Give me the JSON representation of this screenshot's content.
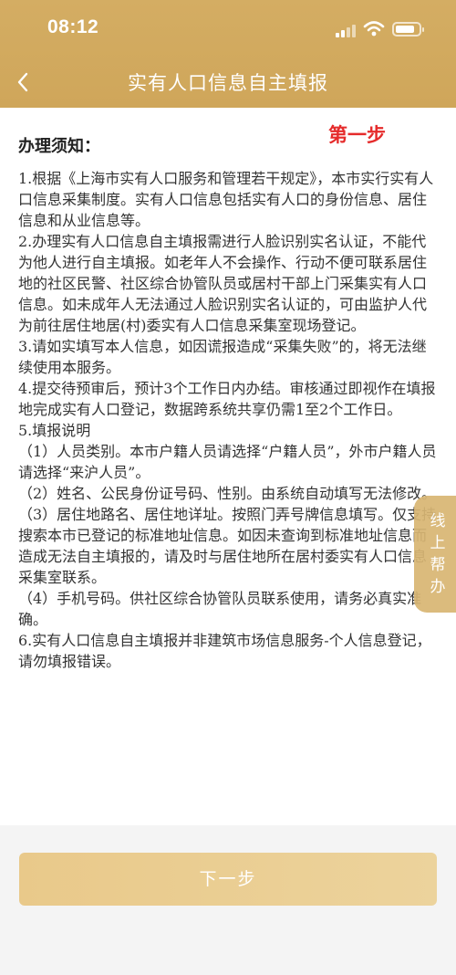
{
  "status_bar": {
    "time": "08:12"
  },
  "header": {
    "title": "实有人口信息自主填报",
    "back_icon": "chevron-left-icon"
  },
  "step_label": "第一步",
  "notice": {
    "title": "办理须知：",
    "paragraphs": [
      "1.根据《上海市实有人口服务和管理若干规定》，本市实行实有人口信息采集制度。实有人口信息包括实有人口的身份信息、居住信息和从业信息等。",
      "2.办理实有人口信息自主填报需进行人脸识别实名认证，不能代为他人进行自主填报。如老年人不会操作、行动不便可联系居住地的社区民警、社区综合协管队员或居村干部上门采集实有人口信息。如未成年人无法通过人脸识别实名认证的，可由监护人代为前往居住地居(村)委实有人口信息采集室现场登记。",
      "3.请如实填写本人信息，如因谎报造成“采集失败”的，将无法继续使用本服务。",
      "4.提交待预审后，预计3个工作日内办结。审核通过即视作在填报地完成实有人口登记，数据跨系统共享仍需1至2个工作日。",
      "5.填报说明",
      "（1）人员类别。本市户籍人员请选择“户籍人员”，外市户籍人员请选择“来沪人员”。",
      "（2）姓名、公民身份证号码、性别。由系统自动填写无法修改。",
      "（3）居住地路名、居住地详址。按照门弄号牌信息填写。仅支持搜索本市已登记的标准地址信息。如因未查询到标准地址信息而造成无法自主填报的，请及时与居住地所在居村委实有人口信息采集室联系。",
      "（4）手机号码。供社区综合协管队员联系使用，请务必真实准确。",
      "6.实有人口信息自主填报并非建筑市场信息服务-个人信息登记，请勿填报错误。"
    ]
  },
  "float_help": {
    "chars": [
      "线",
      "上",
      "帮",
      "办"
    ]
  },
  "footer": {
    "next_label": "下一步"
  },
  "colors": {
    "header": "#d4ad63",
    "step_red": "#e52b2b",
    "button": "#e9c98a",
    "float_help": "#d8b673"
  }
}
